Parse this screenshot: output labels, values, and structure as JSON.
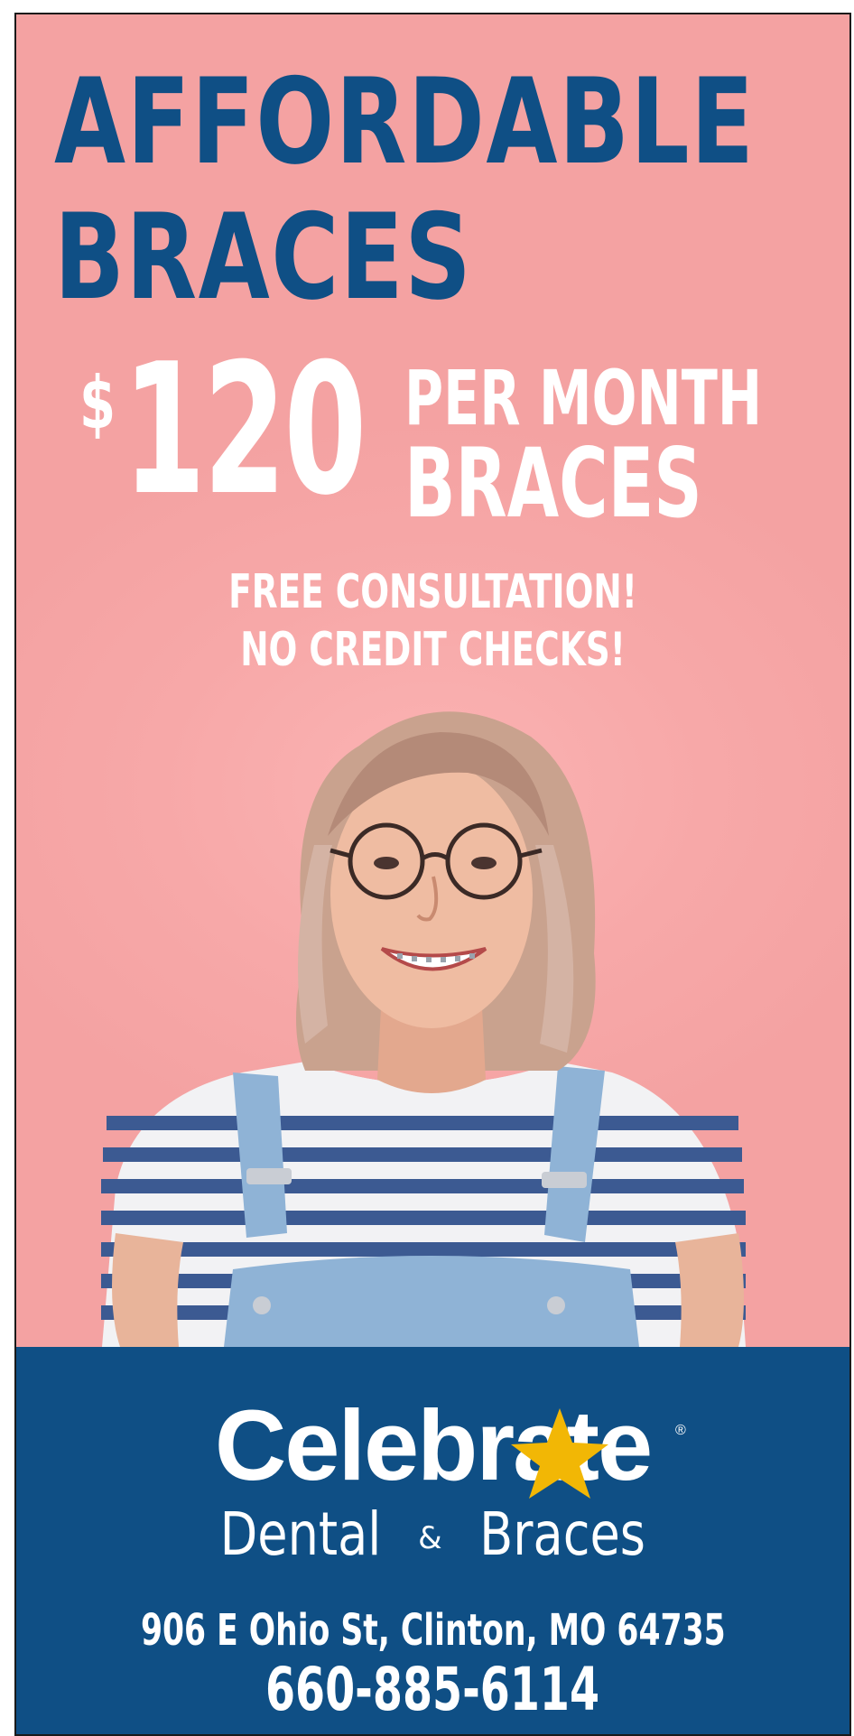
{
  "headline": {
    "line1": "AFFORDABLE",
    "line2": "BRACES"
  },
  "offer": {
    "currency": "$",
    "amount": "120",
    "line1": "PER MONTH",
    "line2": "BRACES"
  },
  "perks": {
    "line1": "FREE CONSULTATION!",
    "line2": "NO CREDIT CHECKS!"
  },
  "brand": {
    "name": "Celebrate",
    "registered": "®",
    "subtitle_left": "Dental",
    "subtitle_amp": "&",
    "subtitle_right": "Braces"
  },
  "contact": {
    "address": "906 E Ohio St, Clinton, MO 64735",
    "phone": "660-885-6114"
  },
  "colors": {
    "background_pink": "#f4a2a2",
    "brand_blue": "#0f4f85",
    "star_yellow": "#f2b705"
  }
}
